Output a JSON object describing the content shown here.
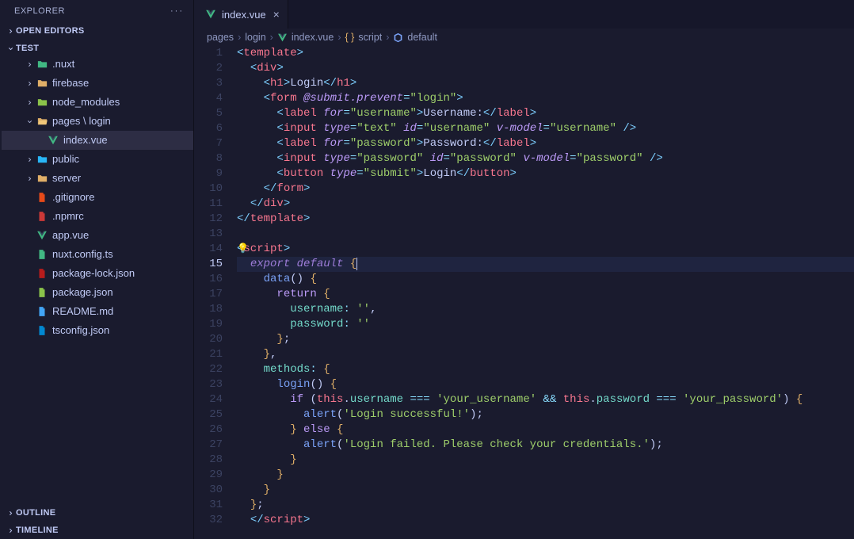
{
  "sidebar": {
    "title": "EXPLORER",
    "sections": {
      "openEditors": "OPEN EDITORS",
      "outline": "OUTLINE",
      "timeline": "TIMELINE",
      "workspace": "TEST"
    },
    "tree": [
      {
        "label": ".nuxt",
        "iconColor": "#41b883",
        "kind": "folder-special"
      },
      {
        "label": "firebase",
        "kind": "folder"
      },
      {
        "label": "node_modules",
        "iconColor": "#8bc34a",
        "kind": "folder-special"
      },
      {
        "label": "pages \\ login",
        "kind": "folder-open"
      },
      {
        "label": "index.vue",
        "kind": "vue",
        "active": true
      },
      {
        "label": "public",
        "iconColor": "#29b6f6",
        "kind": "folder-special"
      },
      {
        "label": "server",
        "kind": "folder"
      },
      {
        "label": ".gitignore",
        "iconColor": "#e64a19",
        "kind": "file"
      },
      {
        "label": ".npmrc",
        "iconColor": "#cb3837",
        "kind": "file"
      },
      {
        "label": "app.vue",
        "kind": "vue"
      },
      {
        "label": "nuxt.config.ts",
        "iconColor": "#41b883",
        "kind": "file"
      },
      {
        "label": "package-lock.json",
        "iconColor": "#b71c1c",
        "kind": "file"
      },
      {
        "label": "package.json",
        "iconColor": "#8bc34a",
        "kind": "file"
      },
      {
        "label": "README.md",
        "iconColor": "#42a5f5",
        "kind": "file"
      },
      {
        "label": "tsconfig.json",
        "iconColor": "#0288d1",
        "kind": "file"
      }
    ]
  },
  "tabs": [
    {
      "label": "index.vue",
      "icon": "vue"
    }
  ],
  "breadcrumbs": [
    {
      "label": "pages"
    },
    {
      "label": "login"
    },
    {
      "label": "index.vue",
      "icon": "vue"
    },
    {
      "label": "script",
      "icon": "braces"
    },
    {
      "label": "default",
      "icon": "cube"
    }
  ],
  "activeLine": 15,
  "code": [
    [
      [
        "tk-punc",
        "<"
      ],
      [
        "tk-tag",
        "template"
      ],
      [
        "tk-punc",
        ">"
      ]
    ],
    [
      [
        "sp",
        "  "
      ],
      [
        "tk-punc",
        "<"
      ],
      [
        "tk-tag",
        "div"
      ],
      [
        "tk-punc",
        ">"
      ]
    ],
    [
      [
        "sp",
        "    "
      ],
      [
        "tk-punc",
        "<"
      ],
      [
        "tk-tag",
        "h1"
      ],
      [
        "tk-punc",
        ">"
      ],
      [
        "tk-txt",
        "Login"
      ],
      [
        "tk-punc",
        "</"
      ],
      [
        "tk-tag",
        "h1"
      ],
      [
        "tk-punc",
        ">"
      ]
    ],
    [
      [
        "sp",
        "    "
      ],
      [
        "tk-punc",
        "<"
      ],
      [
        "tk-tag",
        "form"
      ],
      [
        "sp",
        " "
      ],
      [
        "tk-attr",
        "@submit.prevent"
      ],
      [
        "tk-op",
        "="
      ],
      [
        "tk-str",
        "\"login\""
      ],
      [
        "tk-punc",
        ">"
      ]
    ],
    [
      [
        "sp",
        "      "
      ],
      [
        "tk-punc",
        "<"
      ],
      [
        "tk-tag",
        "label"
      ],
      [
        "sp",
        " "
      ],
      [
        "tk-attr",
        "for"
      ],
      [
        "tk-op",
        "="
      ],
      [
        "tk-str",
        "\"username\""
      ],
      [
        "tk-punc",
        ">"
      ],
      [
        "tk-txt",
        "Username:"
      ],
      [
        "tk-punc",
        "</"
      ],
      [
        "tk-tag",
        "label"
      ],
      [
        "tk-punc",
        ">"
      ]
    ],
    [
      [
        "sp",
        "      "
      ],
      [
        "tk-punc",
        "<"
      ],
      [
        "tk-tag",
        "input"
      ],
      [
        "sp",
        " "
      ],
      [
        "tk-attr",
        "type"
      ],
      [
        "tk-op",
        "="
      ],
      [
        "tk-str",
        "\"text\""
      ],
      [
        "sp",
        " "
      ],
      [
        "tk-attr",
        "id"
      ],
      [
        "tk-op",
        "="
      ],
      [
        "tk-str",
        "\"username\""
      ],
      [
        "sp",
        " "
      ],
      [
        "tk-attr",
        "v-model"
      ],
      [
        "tk-op",
        "="
      ],
      [
        "tk-str",
        "\"username\""
      ],
      [
        "sp",
        " "
      ],
      [
        "tk-punc",
        "/>"
      ]
    ],
    [
      [
        "sp",
        "      "
      ],
      [
        "tk-punc",
        "<"
      ],
      [
        "tk-tag",
        "label"
      ],
      [
        "sp",
        " "
      ],
      [
        "tk-attr",
        "for"
      ],
      [
        "tk-op",
        "="
      ],
      [
        "tk-str",
        "\"password\""
      ],
      [
        "tk-punc",
        ">"
      ],
      [
        "tk-txt",
        "Password:"
      ],
      [
        "tk-punc",
        "</"
      ],
      [
        "tk-tag",
        "label"
      ],
      [
        "tk-punc",
        ">"
      ]
    ],
    [
      [
        "sp",
        "      "
      ],
      [
        "tk-punc",
        "<"
      ],
      [
        "tk-tag",
        "input"
      ],
      [
        "sp",
        " "
      ],
      [
        "tk-attr",
        "type"
      ],
      [
        "tk-op",
        "="
      ],
      [
        "tk-str",
        "\"password\""
      ],
      [
        "sp",
        " "
      ],
      [
        "tk-attr",
        "id"
      ],
      [
        "tk-op",
        "="
      ],
      [
        "tk-str",
        "\"password\""
      ],
      [
        "sp",
        " "
      ],
      [
        "tk-attr",
        "v-model"
      ],
      [
        "tk-op",
        "="
      ],
      [
        "tk-str",
        "\"password\""
      ],
      [
        "sp",
        " "
      ],
      [
        "tk-punc",
        "/>"
      ]
    ],
    [
      [
        "sp",
        "      "
      ],
      [
        "tk-punc",
        "<"
      ],
      [
        "tk-tag",
        "button"
      ],
      [
        "sp",
        " "
      ],
      [
        "tk-attr",
        "type"
      ],
      [
        "tk-op",
        "="
      ],
      [
        "tk-str",
        "\"submit\""
      ],
      [
        "tk-punc",
        ">"
      ],
      [
        "tk-txt",
        "Login"
      ],
      [
        "tk-punc",
        "</"
      ],
      [
        "tk-tag",
        "button"
      ],
      [
        "tk-punc",
        ">"
      ]
    ],
    [
      [
        "sp",
        "    "
      ],
      [
        "tk-punc",
        "</"
      ],
      [
        "tk-tag",
        "form"
      ],
      [
        "tk-punc",
        ">"
      ]
    ],
    [
      [
        "sp",
        "  "
      ],
      [
        "tk-punc",
        "</"
      ],
      [
        "tk-tag",
        "div"
      ],
      [
        "tk-punc",
        ">"
      ]
    ],
    [
      [
        "tk-punc",
        "</"
      ],
      [
        "tk-tag",
        "template"
      ],
      [
        "tk-punc",
        ">"
      ]
    ],
    [
      [
        "sp",
        ""
      ]
    ],
    [
      [
        "bulb",
        "💡"
      ],
      [
        "tk-punc",
        "<"
      ],
      [
        "tk-tag",
        "script"
      ],
      [
        "tk-punc",
        ">"
      ]
    ],
    [
      [
        "sp",
        "  "
      ],
      [
        "tk-kw-it",
        "export"
      ],
      [
        "sp",
        " "
      ],
      [
        "tk-kw-it",
        "default"
      ],
      [
        "sp",
        " "
      ],
      [
        "tk-punc-y",
        "{"
      ],
      [
        "caret",
        ""
      ]
    ],
    [
      [
        "sp",
        "    "
      ],
      [
        "tk-fn",
        "data"
      ],
      [
        "tk-white",
        "()"
      ],
      [
        "sp",
        " "
      ],
      [
        "tk-punc-y",
        "{"
      ]
    ],
    [
      [
        "sp",
        "      "
      ],
      [
        "tk-kw",
        "return"
      ],
      [
        "sp",
        " "
      ],
      [
        "tk-punc-y",
        "{"
      ]
    ],
    [
      [
        "sp",
        "        "
      ],
      [
        "tk-prop",
        "username"
      ],
      [
        "tk-op",
        ":"
      ],
      [
        "sp",
        " "
      ],
      [
        "tk-str",
        "''"
      ],
      [
        "tk-white",
        ","
      ]
    ],
    [
      [
        "sp",
        "        "
      ],
      [
        "tk-prop",
        "password"
      ],
      [
        "tk-op",
        ":"
      ],
      [
        "sp",
        " "
      ],
      [
        "tk-str",
        "''"
      ]
    ],
    [
      [
        "sp",
        "      "
      ],
      [
        "tk-punc-y",
        "}"
      ],
      [
        "tk-white",
        ";"
      ]
    ],
    [
      [
        "sp",
        "    "
      ],
      [
        "tk-punc-y",
        "}"
      ],
      [
        "tk-white",
        ","
      ]
    ],
    [
      [
        "sp",
        "    "
      ],
      [
        "tk-prop",
        "methods"
      ],
      [
        "tk-op",
        ":"
      ],
      [
        "sp",
        " "
      ],
      [
        "tk-punc-y",
        "{"
      ]
    ],
    [
      [
        "sp",
        "      "
      ],
      [
        "tk-fn",
        "login"
      ],
      [
        "tk-white",
        "()"
      ],
      [
        "sp",
        " "
      ],
      [
        "tk-punc-y",
        "{"
      ]
    ],
    [
      [
        "sp",
        "        "
      ],
      [
        "tk-kw",
        "if"
      ],
      [
        "sp",
        " "
      ],
      [
        "tk-white",
        "("
      ],
      [
        "tk-this",
        "this"
      ],
      [
        "tk-white",
        "."
      ],
      [
        "tk-prop",
        "username"
      ],
      [
        "sp",
        " "
      ],
      [
        "tk-op",
        "==="
      ],
      [
        "sp",
        " "
      ],
      [
        "tk-str",
        "'your_username'"
      ],
      [
        "sp",
        " "
      ],
      [
        "tk-op",
        "&&"
      ],
      [
        "sp",
        " "
      ],
      [
        "tk-this",
        "this"
      ],
      [
        "tk-white",
        "."
      ],
      [
        "tk-prop",
        "password"
      ],
      [
        "sp",
        " "
      ],
      [
        "tk-op",
        "==="
      ],
      [
        "sp",
        " "
      ],
      [
        "tk-str",
        "'your_password'"
      ],
      [
        "tk-white",
        ")"
      ],
      [
        "sp",
        " "
      ],
      [
        "tk-punc-y",
        "{"
      ]
    ],
    [
      [
        "sp",
        "          "
      ],
      [
        "tk-fn",
        "alert"
      ],
      [
        "tk-white",
        "("
      ],
      [
        "tk-str",
        "'Login successful!'"
      ],
      [
        "tk-white",
        ")"
      ],
      [
        "tk-white",
        ";"
      ]
    ],
    [
      [
        "sp",
        "        "
      ],
      [
        "tk-punc-y",
        "}"
      ],
      [
        "sp",
        " "
      ],
      [
        "tk-kw",
        "else"
      ],
      [
        "sp",
        " "
      ],
      [
        "tk-punc-y",
        "{"
      ]
    ],
    [
      [
        "sp",
        "          "
      ],
      [
        "tk-fn",
        "alert"
      ],
      [
        "tk-white",
        "("
      ],
      [
        "tk-str",
        "'Login failed. Please check your credentials.'"
      ],
      [
        "tk-white",
        ")"
      ],
      [
        "tk-white",
        ";"
      ]
    ],
    [
      [
        "sp",
        "        "
      ],
      [
        "tk-punc-y",
        "}"
      ]
    ],
    [
      [
        "sp",
        "      "
      ],
      [
        "tk-punc-y",
        "}"
      ]
    ],
    [
      [
        "sp",
        "    "
      ],
      [
        "tk-punc-y",
        "}"
      ]
    ],
    [
      [
        "sp",
        "  "
      ],
      [
        "tk-punc-y",
        "}"
      ],
      [
        "tk-white",
        ";"
      ]
    ],
    [
      [
        "sp",
        "  "
      ],
      [
        "tk-punc",
        "</"
      ],
      [
        "tk-tag",
        "script"
      ],
      [
        "tk-punc",
        ">"
      ]
    ]
  ]
}
